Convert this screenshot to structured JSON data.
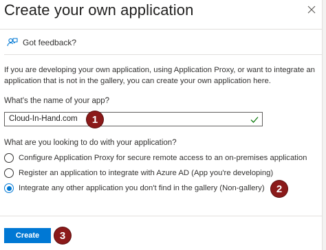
{
  "dialog": {
    "title": "Create your own application",
    "feedback_label": "Got feedback?",
    "intro": "If you are developing your own application, using Application Proxy, or want to integrate an application that is not in the gallery, you can create your own application here."
  },
  "name_field": {
    "label": "What's the name of your app?",
    "value": "Cloud-In-Hand.com"
  },
  "purpose": {
    "label": "What are you looking to do with your application?",
    "options": [
      {
        "label": "Configure Application Proxy for secure remote access to an on-premises application",
        "selected": false
      },
      {
        "label": "Register an application to integrate with Azure AD (App you're developing)",
        "selected": false
      },
      {
        "label": "Integrate any other application you don't find in the gallery (Non-gallery)",
        "selected": true
      }
    ]
  },
  "footer": {
    "create_label": "Create"
  },
  "callouts": [
    "1",
    "2",
    "3"
  ],
  "colors": {
    "accent": "#0078d4",
    "callout": "#8b1a1a",
    "valid": "#107c10"
  }
}
